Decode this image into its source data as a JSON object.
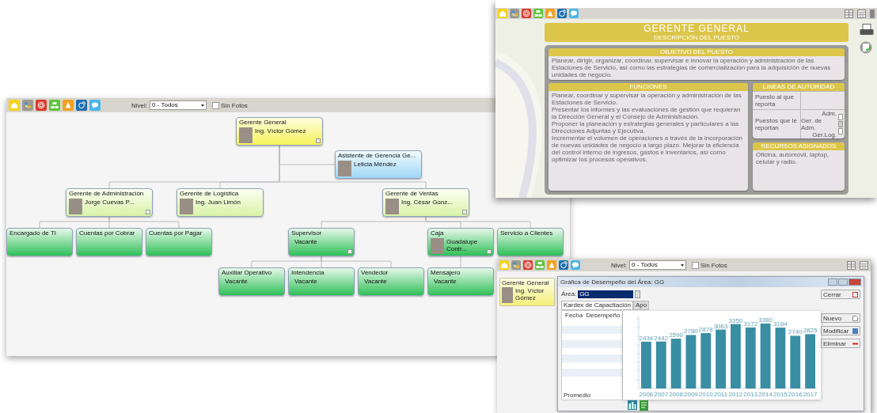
{
  "org_window": {
    "toolbar": {
      "level_label": "Nivel:",
      "level_select": "0 - Todos",
      "hide_photos": {
        "label": "Sin Fotos",
        "checked": false
      }
    },
    "org_chart": {
      "root": {
        "title": "Gerente General",
        "name": "Ing. Víctor Gómez",
        "kind": "root",
        "photo": true,
        "collapsible": true,
        "children": [
          {
            "title": "Asistente de Gerencia Ge...",
            "name": "Leticia Méndez",
            "kind": "assistant",
            "photo": true,
            "collapsible": false
          },
          {
            "title": "Gerente de Administración",
            "name": "Jorge Cuevas P...",
            "kind": "manager",
            "photo": true,
            "collapsible": true,
            "children": [
              {
                "title": "Encargado de TI",
                "kind": "position",
                "photo": false,
                "collapsible": false
              },
              {
                "title": "Cuentas por Cobrar",
                "kind": "position",
                "photo": false,
                "collapsible": false
              },
              {
                "title": "Cuentas por Pagar",
                "kind": "position",
                "photo": false,
                "collapsible": false
              }
            ]
          },
          {
            "title": "Gerente de Logística",
            "name": "Ing. Juan Limón",
            "kind": "manager",
            "photo": true,
            "collapsible": false
          },
          {
            "title": "Gerente de Ventas",
            "name": "Ing. César Gonz...",
            "kind": "manager",
            "photo": true,
            "collapsible": true,
            "children": [
              {
                "title": "Supervisor",
                "name": "Vacante",
                "kind": "position",
                "photo": false,
                "collapsible": true,
                "children": [
                  {
                    "title": "Auxiliar Operativo",
                    "name": "Vacante",
                    "kind": "position",
                    "photo": false,
                    "collapsible": false
                  },
                  {
                    "title": "Intendencia",
                    "name": "Vacante",
                    "kind": "position",
                    "photo": false,
                    "collapsible": false
                  },
                  {
                    "title": "Vendedor",
                    "name": "Vacante",
                    "kind": "position",
                    "photo": false,
                    "collapsible": false
                  }
                ]
              },
              {
                "title": "Caja",
                "name": "Guadalupe Contr...",
                "kind": "position",
                "photo": true,
                "collapsible": true,
                "children": [
                  {
                    "title": "Mensajero",
                    "name": "Vacante",
                    "kind": "position",
                    "photo": false,
                    "collapsible": false
                  }
                ]
              },
              {
                "title": "Servicio a Clientes",
                "kind": "position",
                "photo": false,
                "collapsible": false
              }
            ]
          }
        ]
      }
    }
  },
  "job_window": {
    "title": "GERENTE GENERAL",
    "subtitle": "DESCRIPCIÓN DEL PUESTO",
    "objective": {
      "heading": "OBJETIVO DEL PUESTO",
      "text": "Planear, dirigir, organizar, coordinar, supervisar e innovar la operación y administración de las Estaciones de Servicio, así como las estrategias de comercialización para la adquisición de nuevas unidades de negocio."
    },
    "functions": {
      "heading": "FUNCIONES",
      "items": [
        "Planear, coordinar y supervisar la operación y administración de las Estaciones de Servicio.",
        "Presentar los informes y las evaluaciones de gestión que requieran la Dirección General y el Consejo de Administración.",
        "Proponer la planeación y estrategias generales y particulares a las Direcciones Adjuntas y Ejecutiva.",
        "Incrementar el volumen de operaciones a través de la incorporación de nuevas unidades de negocio a largo plazo. Mejorar la eficiencia del control interno de ingresos, gastos e inventarios, así como optimizar los procesos operativos."
      ]
    },
    "authority": {
      "heading": "LINEAS DE AUTORIDAD",
      "rows": [
        {
          "label": "Puesto al que reporta"
        },
        {
          "label": "Puestos que le reportan",
          "values": [
            "Adm.",
            "Ger. de Adm.",
            "Ger.Log."
          ]
        }
      ]
    },
    "resources": {
      "heading": "RECURSOS ASIGNADOS",
      "text": "Oficina, automóvil, laptop, celular y radio."
    }
  },
  "chart_window": {
    "toolbar": {
      "level_label": "Nivel:",
      "level_select": "0 - Todos",
      "hide_photos": {
        "label": "Sin Fotos",
        "checked": false
      }
    },
    "mini_node": {
      "title": "Gerente General",
      "name": "Ing. Víctor Gómez"
    },
    "dialog": {
      "title": "Gráfica de Desempeño del Área: GG",
      "area_label": "Área:",
      "area_select": "GG",
      "tabs": [
        {
          "label": "Kardex de Capacitación",
          "selected": true
        },
        {
          "label": "Apo",
          "selected": false
        }
      ],
      "table": {
        "columns": [
          "Fecha",
          "Desempeño"
        ],
        "footer": "Promedio"
      },
      "buttons": [
        {
          "label": "Cerrar",
          "kind": "close"
        },
        {
          "label": "Nuevo",
          "kind": "new"
        },
        {
          "label": "Modificar",
          "kind": "edit"
        },
        {
          "label": "Eliminar",
          "kind": "delete"
        }
      ],
      "chart_data": {
        "type": "bar",
        "categories": [
          "2006",
          "2007",
          "2008",
          "2009",
          "2010",
          "2011",
          "2012",
          "2013",
          "2014",
          "2015",
          "2016",
          "2017"
        ],
        "series": [
          {
            "color": "#3a8ea4",
            "values": [
              2434,
              2442,
              2590,
              2780,
              2878,
              3063,
              3350,
              3172,
              3380,
              3164,
              2740,
              2825
            ]
          }
        ],
        "data_labels": true
      }
    }
  }
}
